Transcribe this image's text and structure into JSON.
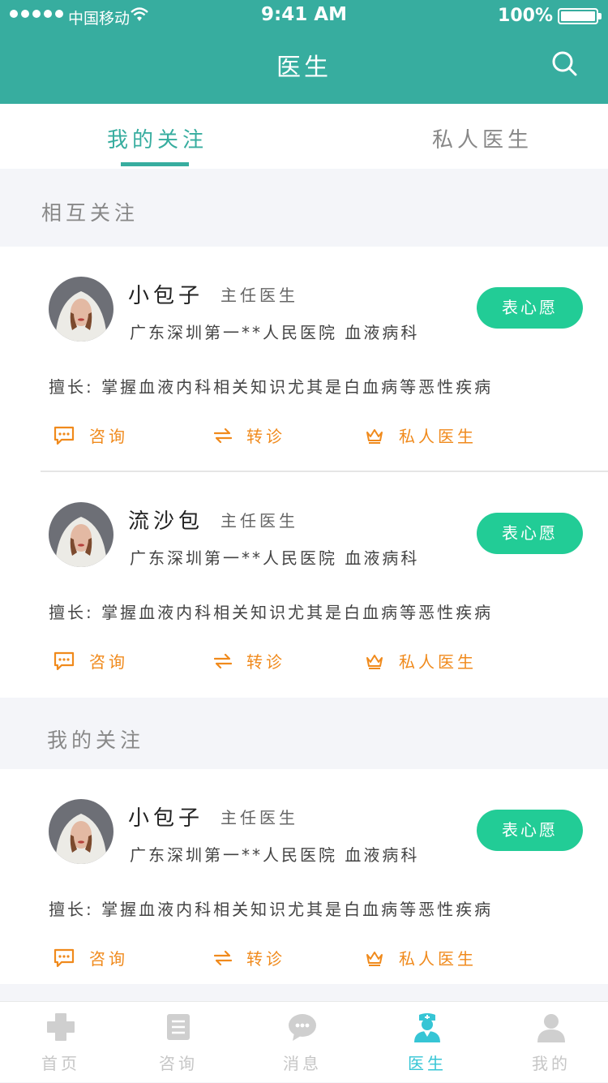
{
  "status_bar": {
    "carrier": "中国移动",
    "time": "9:41 AM",
    "battery": "100%"
  },
  "header": {
    "title": "医生"
  },
  "tabs": [
    {
      "label": "我的关注"
    },
    {
      "label": "私人医生"
    }
  ],
  "sections": {
    "mutual": "相互关注",
    "following": "我的关注"
  },
  "cards": [
    {
      "name": "小包子",
      "rank": "主任医生",
      "hospital": "广东深圳第一**人民医院  血液病科",
      "wish": "表心愿",
      "specialty": "擅长:  掌握血液内科相关知识尤其是白血病等恶性疾病",
      "actions": [
        "咨询",
        "转诊",
        "私人医生"
      ]
    },
    {
      "name": "流沙包",
      "rank": "主任医生",
      "hospital": "广东深圳第一**人民医院  血液病科",
      "wish": "表心愿",
      "specialty": "擅长:  掌握血液内科相关知识尤其是白血病等恶性疾病",
      "actions": [
        "咨询",
        "转诊",
        "私人医生"
      ]
    },
    {
      "name": "小包子",
      "rank": "主任医生",
      "hospital": "广东深圳第一**人民医院  血液病科",
      "wish": "表心愿",
      "specialty": "擅长:  掌握血液内科相关知识尤其是白血病等恶性疾病",
      "actions": [
        "咨询",
        "转诊",
        "私人医生"
      ]
    }
  ],
  "bottom_nav": [
    {
      "label": "首页",
      "icon": "cross-icon"
    },
    {
      "label": "咨询",
      "icon": "document-icon"
    },
    {
      "label": "消息",
      "icon": "chat-icon"
    },
    {
      "label": "医生",
      "icon": "doctor-icon",
      "active": true
    },
    {
      "label": "我的",
      "icon": "user-icon"
    }
  ],
  "colors": {
    "primary": "#37ad9f",
    "wish_button": "#22cc96",
    "action": "#f08a1c",
    "nav_active": "#36c5d5"
  }
}
